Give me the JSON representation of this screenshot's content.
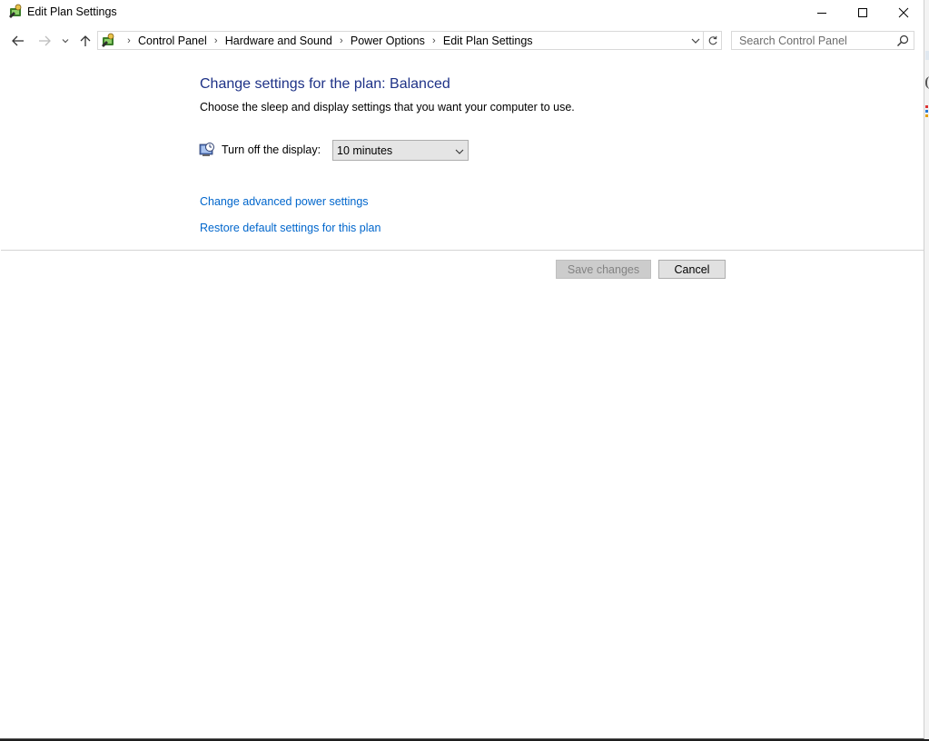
{
  "window": {
    "title": "Edit Plan Settings"
  },
  "navigation": {
    "breadcrumbs": [
      {
        "label": "Control Panel"
      },
      {
        "label": "Hardware and Sound"
      },
      {
        "label": "Power Options"
      },
      {
        "label": "Edit Plan Settings"
      }
    ],
    "search_placeholder": "Search Control Panel"
  },
  "content": {
    "heading": "Change settings for the plan: Balanced",
    "subheading": "Choose the sleep and display settings that you want your computer to use.",
    "display_label": "Turn off the display:",
    "display_value": "10 minutes",
    "links": {
      "advanced": "Change advanced power settings",
      "restore": "Restore default settings for this plan"
    }
  },
  "buttons": {
    "save_label": "Save changes",
    "cancel_label": "Cancel"
  },
  "icons": {
    "app": "control-panel-icon",
    "back": "back-arrow-icon",
    "forward": "forward-arrow-icon",
    "recent": "chevron-down-icon",
    "up": "up-arrow-icon",
    "refresh": "refresh-icon",
    "search": "search-icon",
    "display": "display-timer-icon"
  },
  "colors": {
    "heading": "#1e3287",
    "link": "#0066cc",
    "disabled_text": "#838383"
  }
}
